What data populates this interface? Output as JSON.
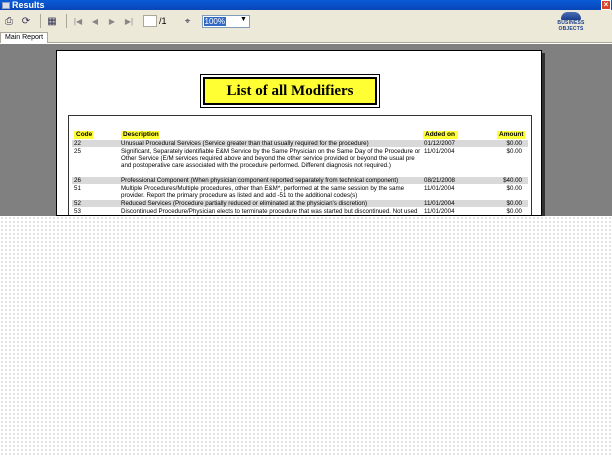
{
  "window": {
    "title": "Results"
  },
  "toolbar": {
    "page_total": "/1",
    "zoom_value": "100%",
    "logo_text": "BUSINESS OBJECTS"
  },
  "tabs": [
    {
      "label": "Main Report"
    }
  ],
  "report": {
    "title": "List of all Modifiers",
    "columns": {
      "code": "Code",
      "description": "Description",
      "added_on": "Added on",
      "amount": "Amount"
    },
    "rows": [
      {
        "code": "22",
        "description": "Unusual Procedural Services (Service greater than that usually required for the procedure)",
        "added_on": "01/12/2007",
        "amount": "$0.00"
      },
      {
        "code": "25",
        "description": "Significant, Separately identifiable E&M Service by the Same Physician on the Same Day of the Procedure or Other Service (E/M services required above and beyond the other service provided or beyond the usual pre and postoperative care associated with the procedure performed. Different diagnosis not required.)",
        "added_on": "11/01/2004",
        "amount": "$0.00"
      },
      {
        "code": "26",
        "description": "Professional Component (When physician component reported separately from technical component)",
        "added_on": "08/21/2008",
        "amount": "$40.00"
      },
      {
        "code": "51",
        "description": "Multiple Procedures/Multiple procedures, other than E&M*, performed at the same session by the same provider. Report the primary procedure as listed and add -51 to the additional codes(s)",
        "added_on": "11/01/2004",
        "amount": "$0.00"
      },
      {
        "code": "52",
        "description": "Reduced Services (Procedure partially reduced or eliminated at the physician's discretion)",
        "added_on": "11/01/2004",
        "amount": "$0.00"
      },
      {
        "code": "53",
        "description": "Discontinued Procedure/Physician elects to terminate procedure that was started but discontinued. Not used for elective cancellation of a procedure prior to patients anesthesia induction and/or surgical",
        "added_on": "11/01/2004",
        "amount": "$0.00"
      }
    ]
  }
}
